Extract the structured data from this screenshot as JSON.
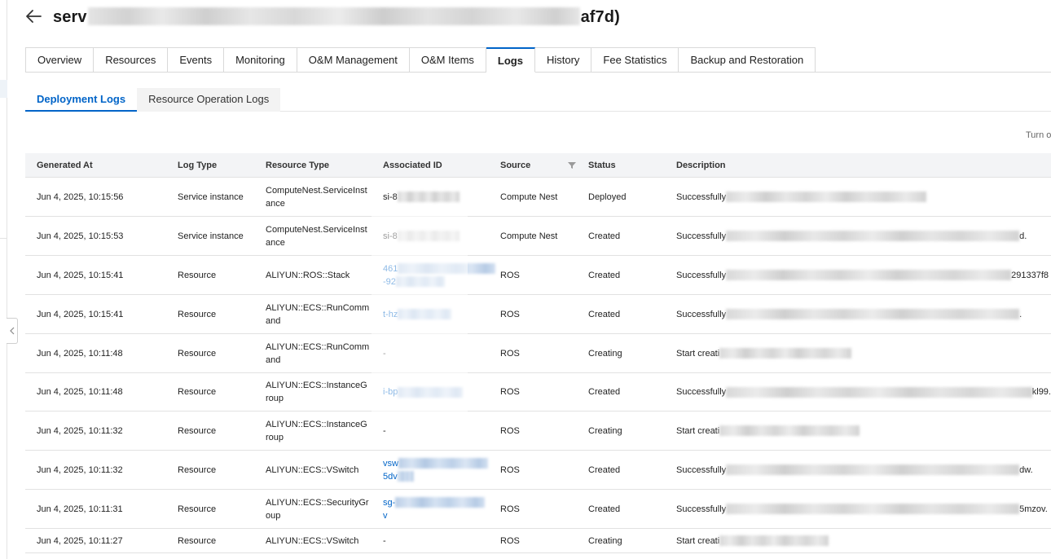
{
  "header": {
    "back_icon": "arrow-left-icon",
    "title_prefix": "serv",
    "title_suffix": "af7d)"
  },
  "tabs": [
    {
      "label": "Overview",
      "active": false
    },
    {
      "label": "Resources",
      "active": false
    },
    {
      "label": "Events",
      "active": false
    },
    {
      "label": "Monitoring",
      "active": false
    },
    {
      "label": "O&M Management",
      "active": false
    },
    {
      "label": "O&M Items",
      "active": false
    },
    {
      "label": "Logs",
      "active": true
    },
    {
      "label": "History",
      "active": false
    },
    {
      "label": "Fee Statistics",
      "active": false
    },
    {
      "label": "Backup and Restoration",
      "active": false
    }
  ],
  "subtabs": [
    {
      "label": "Deployment Logs",
      "active": true
    },
    {
      "label": "Resource Operation Logs",
      "active": false
    }
  ],
  "toolbar": {
    "turn_on_text": "Turn o"
  },
  "table": {
    "columns": [
      "Generated At",
      "Log Type",
      "Resource Type",
      "Associated ID",
      "Source",
      "Status",
      "Description"
    ],
    "filter_icon": "filter-icon",
    "rows": [
      {
        "generated_at": "Jun 4, 2025, 10:15:56",
        "log_type": "Service instance",
        "resource_type": "ComputeNest.ServiceInstance",
        "associated_id": "si-8",
        "source": "Compute Nest",
        "status": "Deployed",
        "description": "Successfully",
        "description_end": ""
      },
      {
        "generated_at": "Jun 4, 2025, 10:15:53",
        "log_type": "Service instance",
        "resource_type": "ComputeNest.ServiceInstance",
        "associated_id": "si-8",
        "source": "Compute Nest",
        "status": "Created",
        "description": "Successfully",
        "description_end": "d."
      },
      {
        "generated_at": "Jun 4, 2025, 10:15:41",
        "log_type": "Resource",
        "resource_type": "ALIYUN::ROS::Stack",
        "associated_id": "461",
        "associated_id_line2": "-92",
        "source": "ROS",
        "status": "Created",
        "description": "Successfully",
        "description_end": "291337f8"
      },
      {
        "generated_at": "Jun 4, 2025, 10:15:41",
        "log_type": "Resource",
        "resource_type": "ALIYUN::ECS::RunCommand",
        "associated_id": "t-hz",
        "source": "ROS",
        "status": "Created",
        "description": "Successfully",
        "description_end": "."
      },
      {
        "generated_at": "Jun 4, 2025, 10:11:48",
        "log_type": "Resource",
        "resource_type": "ALIYUN::ECS::RunCommand",
        "associated_id": "-",
        "source": "ROS",
        "status": "Creating",
        "description": "Start creati",
        "description_end": ""
      },
      {
        "generated_at": "Jun 4, 2025, 10:11:48",
        "log_type": "Resource",
        "resource_type": "ALIYUN::ECS::InstanceGroup",
        "associated_id": "i-bp",
        "source": "ROS",
        "status": "Created",
        "description": "Successfully",
        "description_end": "kl99."
      },
      {
        "generated_at": "Jun 4, 2025, 10:11:32",
        "log_type": "Resource",
        "resource_type": "ALIYUN::ECS::InstanceGroup",
        "associated_id": "-",
        "source": "ROS",
        "status": "Creating",
        "description": "Start creati",
        "description_end": ""
      },
      {
        "generated_at": "Jun 4, 2025, 10:11:32",
        "log_type": "Resource",
        "resource_type": "ALIYUN::ECS::VSwitch",
        "associated_id": "vsw",
        "associated_id_line2": "5dv",
        "source": "ROS",
        "status": "Created",
        "description": "Successfully",
        "description_end": "dw."
      },
      {
        "generated_at": "Jun 4, 2025, 10:11:31",
        "log_type": "Resource",
        "resource_type": "ALIYUN::ECS::SecurityGroup",
        "associated_id": "sg-",
        "associated_id_line2": "v",
        "source": "ROS",
        "status": "Created",
        "description": "Successfully",
        "description_end": "5mzov."
      },
      {
        "generated_at": "Jun 4, 2025, 10:11:27",
        "log_type": "Resource",
        "resource_type": "ALIYUN::ECS::VSwitch",
        "associated_id": "-",
        "source": "ROS",
        "status": "Creating",
        "description": "Start creati",
        "description_end": ""
      }
    ]
  }
}
